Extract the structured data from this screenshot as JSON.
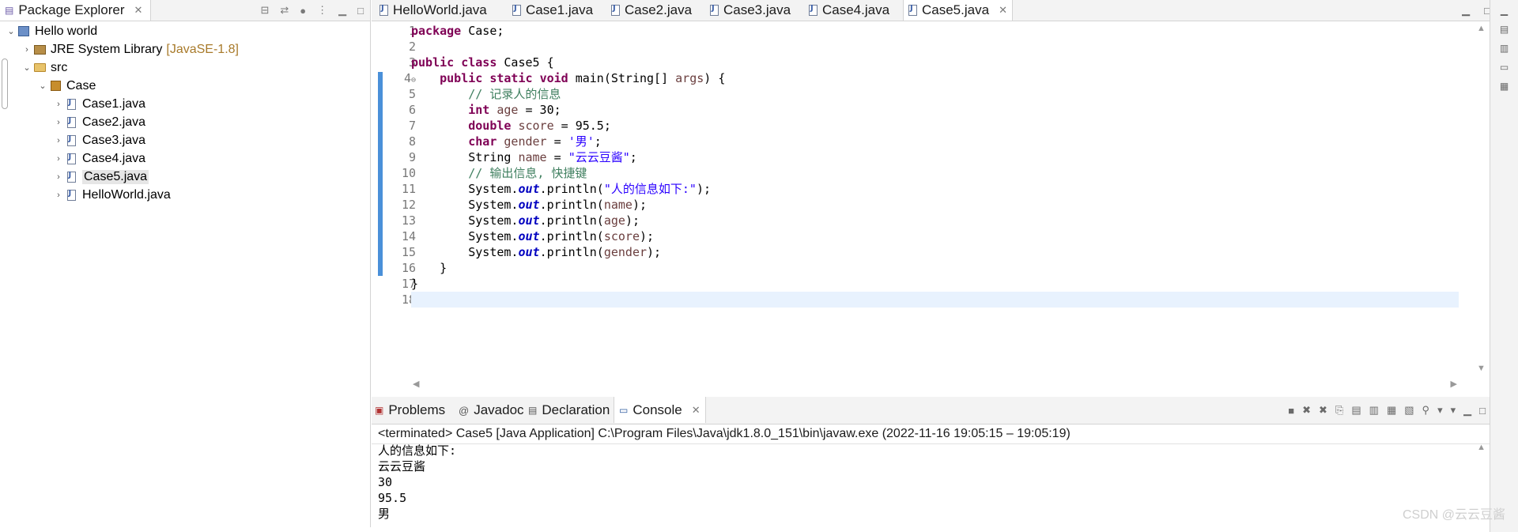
{
  "package_explorer": {
    "tab_label": "Package Explorer",
    "tree": [
      {
        "label": "Hello world",
        "level": 0,
        "icon": "project-icon",
        "expanded": true
      },
      {
        "label": "JRE System Library",
        "decor": "[JavaSE-1.8]",
        "level": 1,
        "icon": "library-icon",
        "expanded": false
      },
      {
        "label": "src",
        "level": 1,
        "icon": "folder-icon",
        "expanded": true
      },
      {
        "label": "Case",
        "level": 2,
        "icon": "package-icon",
        "expanded": true
      },
      {
        "label": "Case1.java",
        "level": 3,
        "icon": "java-file-icon"
      },
      {
        "label": "Case2.java",
        "level": 3,
        "icon": "java-file-icon"
      },
      {
        "label": "Case3.java",
        "level": 3,
        "icon": "java-file-icon"
      },
      {
        "label": "Case4.java",
        "level": 3,
        "icon": "java-file-icon"
      },
      {
        "label": "Case5.java",
        "level": 3,
        "icon": "java-file-icon",
        "selected": true
      },
      {
        "label": "HelloWorld.java",
        "level": 3,
        "icon": "java-file-icon"
      }
    ]
  },
  "editor": {
    "tabs": [
      {
        "label": "HelloWorld.java"
      },
      {
        "label": "Case1.java"
      },
      {
        "label": "Case2.java"
      },
      {
        "label": "Case3.java"
      },
      {
        "label": "Case4.java"
      },
      {
        "label": "Case5.java",
        "active": true
      }
    ],
    "line_numbers": [
      "1",
      "2",
      "3",
      "4",
      "5",
      "6",
      "7",
      "8",
      "9",
      "10",
      "11",
      "12",
      "13",
      "14",
      "15",
      "16",
      "17",
      "18"
    ],
    "code_lines": [
      "package Case;",
      "",
      "public class Case5 {",
      "    public static void main(String[] args) {",
      "        // 记录人的信息",
      "        int age = 30;",
      "        double score = 95.5;",
      "        char gender = '男';",
      "        String name = \"云云豆酱\";",
      "        // 输出信息, 快捷键",
      "        System.out.println(\"人的信息如下:\");",
      "        System.out.println(name);",
      "        System.out.println(age);",
      "        System.out.println(score);",
      "        System.out.println(gender);",
      "    }",
      "}",
      ""
    ]
  },
  "console": {
    "tabs": [
      {
        "label": "Problems"
      },
      {
        "label": "Javadoc"
      },
      {
        "label": "Declaration"
      },
      {
        "label": "Console",
        "active": true
      }
    ],
    "status": "<terminated> Case5 [Java Application] C:\\Program Files\\Java\\jdk1.8.0_151\\bin\\javaw.exe  (2022-11-16 19:05:15 – 19:05:19)",
    "output": [
      "人的信息如下:",
      "云云豆酱",
      "30",
      "95.5",
      "男"
    ]
  },
  "watermark": "CSDN @云云豆酱",
  "colors": {
    "keyword": "#7f0055",
    "comment": "#3f7f5f",
    "string": "#2a00ff",
    "field": "#0000c0",
    "current_line": "#e8f2fe",
    "change_bar": "#4a90d9"
  }
}
